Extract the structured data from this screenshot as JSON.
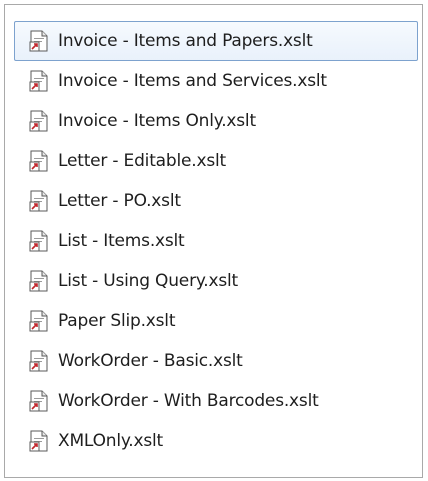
{
  "icon_name": "xslt-shortcut-file-icon",
  "selection_color": "#7da2ce",
  "files": [
    {
      "label": "Invoice - Items and Papers.xslt",
      "selected": true
    },
    {
      "label": "Invoice - Items and Services.xslt",
      "selected": false
    },
    {
      "label": "Invoice - Items Only.xslt",
      "selected": false
    },
    {
      "label": "Letter - Editable.xslt",
      "selected": false
    },
    {
      "label": "Letter - PO.xslt",
      "selected": false
    },
    {
      "label": "List - Items.xslt",
      "selected": false
    },
    {
      "label": "List - Using Query.xslt",
      "selected": false
    },
    {
      "label": "Paper Slip.xslt",
      "selected": false
    },
    {
      "label": "WorkOrder - Basic.xslt",
      "selected": false
    },
    {
      "label": "WorkOrder - With Barcodes.xslt",
      "selected": false
    },
    {
      "label": "XMLOnly.xslt",
      "selected": false
    }
  ]
}
